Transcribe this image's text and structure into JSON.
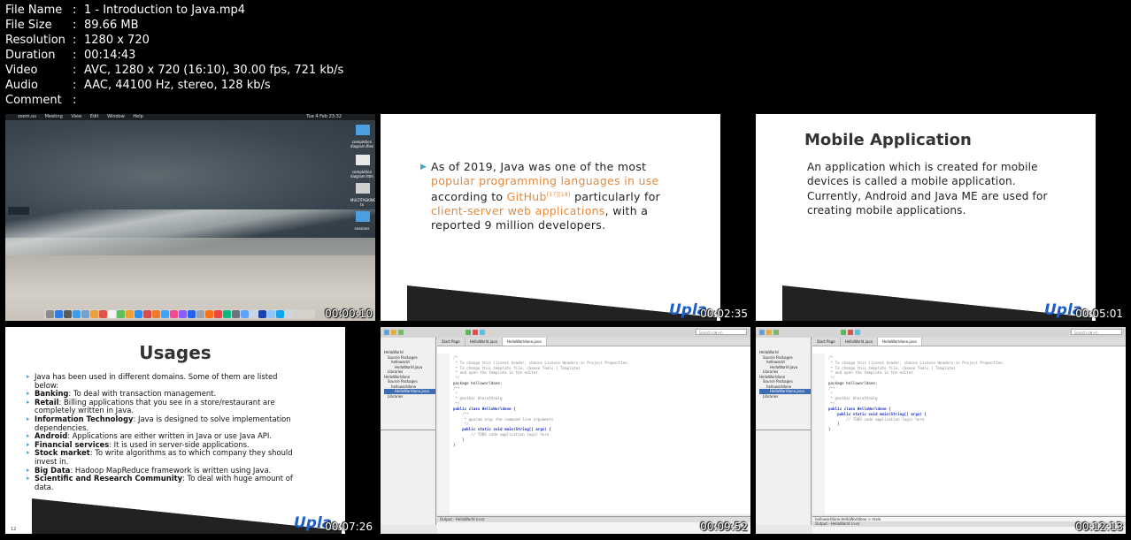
{
  "metadata": [
    {
      "key": "File Name",
      "sep": ":",
      "value": "1 - Introduction to Java.mp4"
    },
    {
      "key": "File Size",
      "sep": ":",
      "value": "89.66 MB"
    },
    {
      "key": "Resolution",
      "sep": ":",
      "value": "1280 x 720"
    },
    {
      "key": "Duration",
      "sep": ":",
      "value": "00:14:43"
    },
    {
      "key": "Video",
      "sep": ":",
      "value": "AVC, 1280 x 720 (16:10), 30.00 fps, 721 kb/s"
    },
    {
      "key": "Audio",
      "sep": ":",
      "value": "AAC, 44100 Hz, stereo, 128 kb/s"
    },
    {
      "key": "Comment",
      "sep": ":",
      "value": ""
    }
  ],
  "thumbs": [
    {
      "timestamp": "00:00:10",
      "menubar": [
        "zoom.us",
        "Meeting",
        "View",
        "Edit",
        "Window",
        "Help"
      ],
      "clock": "Tue 4 Feb 23:32",
      "desktop_files": [
        "completion diagram.files",
        "completion diagram.htm",
        "MULTITASKING.pp tx",
        "sessions"
      ]
    },
    {
      "timestamp": "00:02:35",
      "text_a": "As of 2019, Java was one of the most ",
      "link_a": "popular programming languages in use",
      "text_b": " according to ",
      "link_b": "GitHub",
      "refs": "[17][18]",
      "text_c": " particularly for ",
      "link_c": "client-server web applications",
      "text_d": ", with a reported 9 million developers.",
      "logo_a": "Upla",
      "logo_b": ""
    },
    {
      "timestamp": "00:05:01",
      "title": "Mobile  Application",
      "p1": "An application which is created for mobile devices is called a mobile application.",
      "p2": "Currently, Android and Java ME are used for creating mobile applications.",
      "logo_a": "Upla",
      "logo_b": ""
    },
    {
      "timestamp": "00:07:26",
      "title": "Usages",
      "page_number": "12",
      "items": [
        {
          "b": "",
          "t": "Java has been used in different domains. Some of them are listed below:"
        },
        {
          "b": "Banking",
          "t": ": To deal with transaction management."
        },
        {
          "b": "Retail",
          "t": ": Billing applications that you see in a store/restaurant are completely written in Java."
        },
        {
          "b": "Information Technology",
          "t": ": Java is designed to solve implementation dependencies."
        },
        {
          "b": "Android",
          "t": ": Applications are either written in Java or use Java API."
        },
        {
          "b": "Financial services",
          "t": ": It is used in server-side applications."
        },
        {
          "b": "Stock market",
          "t": ": To write algorithms as to which company they should invest in."
        },
        {
          "b": "Big Data",
          "t": ": Hadoop MapReduce framework is written using Java."
        },
        {
          "b": "Scientific and Research Community",
          "t": ": To deal with huge amount of data."
        }
      ],
      "logo_a": "Upla",
      "logo_b": ""
    },
    {
      "timestamp": "00:09:52",
      "search": "Search (⌘+I)",
      "tabs": [
        "Start Page",
        "HelloWorld.java",
        "HelloWorldone.java"
      ],
      "tree": [
        "HelloWorld",
        "Source Packages",
        "helloworld",
        "HelloWorld.java",
        "Libraries",
        "HelloWorldone",
        "Source Packages",
        "helloworldone",
        "HelloWorldone.java",
        "Libraries"
      ],
      "code": [
        "/*",
        " * To change this license header, choose License Headers in Project Properties.",
        " * To change this template file, choose Tools | Templates",
        " * and open the template in the editor.",
        " */",
        "package helloworldone;",
        "",
        "/**",
        " *",
        " * @author bharathnaig",
        " */",
        "public class HelloWorldone {",
        "",
        "    /**",
        "     * @param args the command line arguments",
        "     */",
        "    public static void main(String[] args) {",
        "        // TODO code application logic here",
        "    }",
        "",
        "}"
      ],
      "output": "Output - HelloWorld (run)"
    },
    {
      "timestamp": "00:12:13",
      "search": "Search (⌘+I)",
      "tabs": [
        "Start Page",
        "HelloWorld.java",
        "HelloWorldone.java"
      ],
      "tree": [
        "HelloWorld",
        "Source Packages",
        "helloworld",
        "HelloWorld.java",
        "Libraries",
        "HelloWorldone",
        "Source Packages",
        "helloworldone",
        "HelloWorldone.java",
        "Libraries"
      ],
      "code": [
        "/*",
        " * To change this license header, choose License Headers in Project Properties.",
        " * To change this template file, choose Tools | Templates",
        " * and open the template in the editor.",
        " */",
        "package helloworldone;",
        "",
        "/**",
        " *",
        " * @author bharathnaig",
        " */",
        "public class HelloWorldone {",
        "",
        "    public static void main(String[] args) {",
        "        // TODO code application logic here",
        "    }",
        "}"
      ],
      "output": "Output - HelloWorld (run)",
      "breadcrumb": "helloworldone.HelloWorldone  >  main"
    }
  ]
}
